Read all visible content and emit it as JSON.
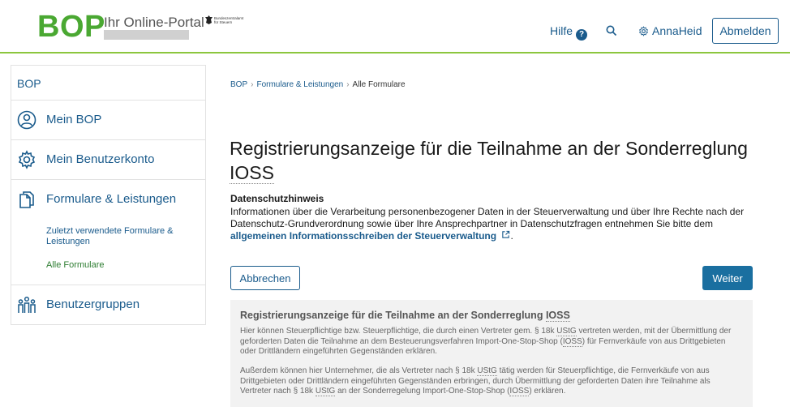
{
  "header": {
    "logo": "BOP",
    "portal_name": "Ihr Online-Portal",
    "agency_lines": [
      "Bundeszentralamt",
      "für Steuern"
    ],
    "help_label": "Hilfe",
    "help_icon_glyph": "?",
    "search_icon": "search-icon",
    "user_name": "AnnaHeid",
    "logout_label": "Abmelden"
  },
  "sidebar": {
    "home": "BOP",
    "items": [
      {
        "label": "Mein BOP",
        "icon": "user-circle-icon"
      },
      {
        "label": "Mein Benutzerkonto",
        "icon": "gear-icon"
      },
      {
        "label": "Formulare & Leistungen",
        "icon": "documents-icon"
      },
      {
        "label": "Benutzergruppen",
        "icon": "group-icon"
      }
    ],
    "subitems": [
      {
        "label": "Zuletzt verwendete Formulare & Leistungen",
        "active": false
      },
      {
        "label": "Alle Formulare",
        "active": true
      }
    ]
  },
  "breadcrumb": [
    "BOP",
    "Formulare & Leistungen",
    "Alle Formulare"
  ],
  "page_title": "Registrierungsanzeige für die Teilnahme an der Sonderreglung",
  "page_title_suffix": "IOSS",
  "privacy": {
    "title": "Datenschutzhinweis",
    "text": "Informationen über die Verarbeitung personenbezogener Daten in der Steuerverwaltung und über Ihre Rechte nach der Datenschutz-Grundverordnung sowie über Ihre Ansprechpartner in Datenschutzfragen entnehmen Sie bitte dem",
    "link": "allgemeinen Informationsschreiben der Steuerverwaltung",
    "end": "."
  },
  "buttons": {
    "cancel": "Abbrechen",
    "next": "Weiter"
  },
  "info": {
    "title_prefix": "Registrierungsanzeige für die Teilnahme an der Sonderreglung",
    "title_abbr": "IOSS",
    "p1": {
      "a": "Hier können Steuerpflichtige bzw. Steuerpflichtige, die durch einen Vertreter gem. § 18k",
      "b": "UStG",
      "c": "vertreten werden, mit der Übermittlung der geforderten Daten die Teilnahme an dem Besteuerungsverfahren Import-One-Stop-Shop (",
      "d": "IOSS",
      "e": ") für Fernverkäufe von aus Drittgebieten oder Drittländern eingeführten Gegenständen erklären."
    },
    "p2": {
      "a": "Außerdem können hier Unternehmer, die als Vertreter nach § 18k",
      "b": "UStG",
      "c": "tätig werden für Steuerpflichtige, die Fernverkäufe von aus Drittgebieten oder Drittländern eingeführten Gegenständen erbringen, durch Übermittlung der geforderten Daten ihre Teilnahme als Vertreter nach § 18k",
      "d": "UStG",
      "e": "an der Sonderregelung Import-One-Stop-Shop (",
      "f": "IOSS",
      "g": ") erklären."
    }
  },
  "colors": {
    "brand_green": "#4aa832",
    "link_blue": "#1a5b8c",
    "primary_button": "#1a6fa0"
  }
}
